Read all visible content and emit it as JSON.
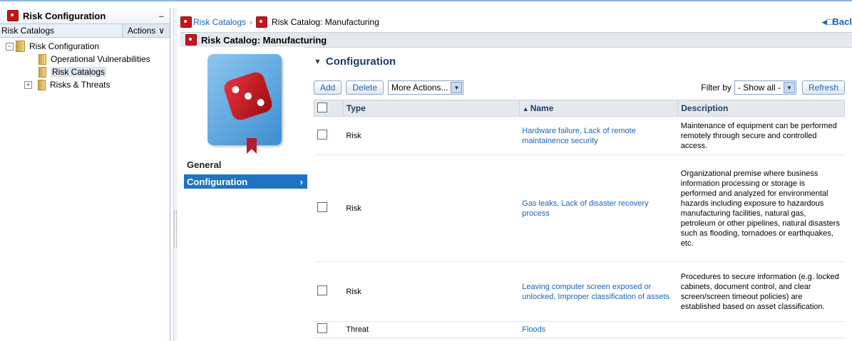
{
  "left_panel": {
    "title": "Risk Configuration",
    "subheader_label": "Risk Catalogs",
    "actions_label": "Actions",
    "tree": {
      "root": "Risk Configuration",
      "children": [
        "Operational Vulnerabilities",
        "Risk Catalogs",
        "Risks & Threats"
      ],
      "selected": "Risk Catalogs"
    }
  },
  "breadcrumb": {
    "parent": "Risk Catalogs",
    "current": "Risk Catalog: Manufacturing",
    "back_label": "Bacl"
  },
  "header": {
    "title": "Risk Catalog: Manufacturing"
  },
  "nav": {
    "tabs": [
      "General",
      "Configuration"
    ],
    "active": "Configuration"
  },
  "content": {
    "title": "Configuration",
    "toolbar": {
      "add": "Add",
      "delete": "Delete",
      "more_actions": "More Actions...",
      "filter_label": "Filter by",
      "filter_value": "- Show all -",
      "refresh": "Refresh"
    },
    "columns": {
      "type": "Type",
      "name": "Name",
      "description": "Description"
    },
    "rows": [
      {
        "type": "Risk",
        "name": "Hardware failure, Lack of remote maintainence security",
        "description": "Maintenance of equipment can be performed remotely through secure and controlled access."
      },
      {
        "type": "Risk",
        "name": "Gas leaks, Lack of disaster recovery process",
        "description": "Organizational premise where business information processing or storage is performed and analyzed for environmental hazards including exposure to hazardous manufacturing facilities, natural gas, petroleum or other pipelines, natural disasters such as flooding, tornadoes or earthquakes, etc."
      },
      {
        "type": "Risk",
        "name": "Leaving computer screen exposed or unlocked, Improper classification of assets",
        "description": "Procedures to secure information (e.g. locked cabinets, document control, and clear screen/screen timeout policies) are established based on asset classification."
      },
      {
        "type": "Threat",
        "name": "Floods",
        "description": ""
      }
    ]
  },
  "colors": {
    "accent": "#1f74c1",
    "link": "#1c63b7",
    "header_bg": "#e5e9ee"
  }
}
